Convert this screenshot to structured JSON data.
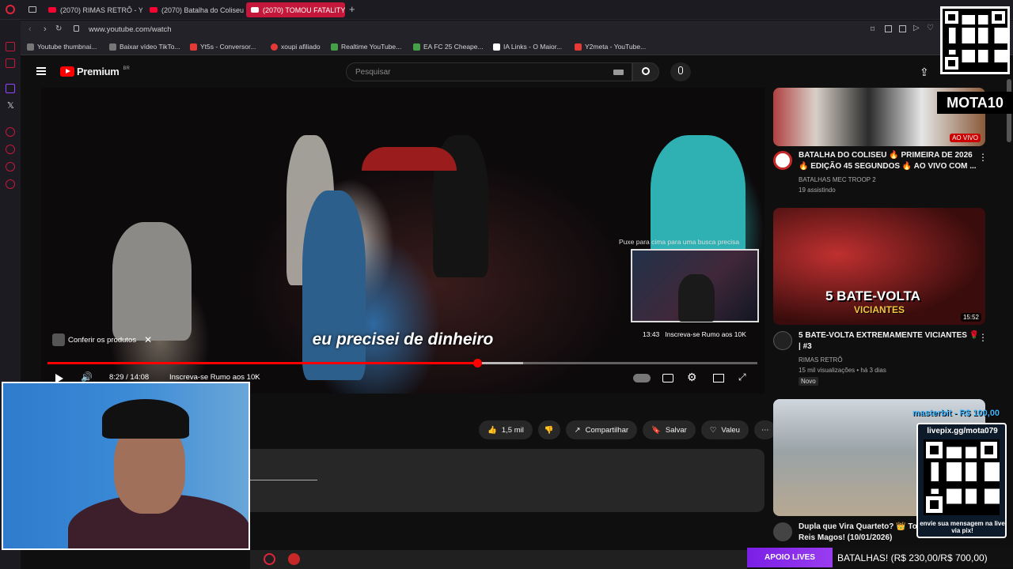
{
  "browser": {
    "tabs": [
      {
        "label": "(2070) RIMAS RETRÔ - Yo",
        "active": false
      },
      {
        "label": "(2070) Batalha do Coliseu",
        "active": false
      },
      {
        "label": "(2070) TOMOU FATALITY,",
        "active": true
      }
    ],
    "url": "www.youtube.com/watch",
    "bookmarks": [
      {
        "label": "Youtube thumbnai...",
        "color": "#777777"
      },
      {
        "label": "Baixar vídeo TikTo...",
        "color": "#777777"
      },
      {
        "label": "Yt5s - Conversor...",
        "color": "#e53935"
      },
      {
        "label": "xoupi afiliado",
        "color": "#e53935"
      },
      {
        "label": "Realtime YouTube...",
        "color": "#43a047"
      },
      {
        "label": "EA FC 25 Cheape...",
        "color": "#43a047"
      },
      {
        "label": "IA Links - O Maior...",
        "color": "#ffffff"
      },
      {
        "label": "Y2meta - YouTube...",
        "color": "#e53935"
      }
    ]
  },
  "youtube": {
    "logo": "Premium",
    "logo_region": "BR",
    "search_placeholder": "Pesquisar"
  },
  "video": {
    "subtitle": "eu precisei de dinheiro",
    "product_button": "Conferir os produtos",
    "pip_hint": "Puxe para cima para uma busca precisa",
    "preview_time": "13:43",
    "preview_label": "Inscreva-se Rumo aos 10K",
    "current_time": "8:29 / 14:08",
    "chapter": "Inscreva-se Rumo aos 10K",
    "progress": 0.605,
    "buffered": 0.67
  },
  "actions": {
    "likes": "1,5 mil",
    "share": "Compartilhar",
    "save": "Salvar",
    "thanks": "Valeu"
  },
  "recommendations": [
    {
      "title": "BATALHA DO COLISEU 🔥 PRIMEIRA DE 2026 🔥 EDIÇÃO 45 SEGUNDOS 🔥 AO VIVO COM ...",
      "channel": "BATALHAS MEC TROOP 2",
      "meta": "19 assistindo",
      "badge": "AO VIVO"
    },
    {
      "title": "5 BATE-VOLTA EXTREMAMENTE VICIANTES 🌹 | #3",
      "channel": "RIMAS RETRÔ",
      "meta": "15 mil visualizações • há 3 dias",
      "badge": "15:52",
      "tag": "Novo",
      "thumb_text": "5 BATE-VOLTA",
      "thumb_sub": "VICIANTES"
    },
    {
      "title": "Dupla que Vira Quarteto? 👑 To... Reis Magos! (10/01/2026)",
      "channel": "",
      "meta": ""
    }
  ],
  "overlay": {
    "streamer": "MOTA10",
    "donor": "masterbit - R$ 100,00",
    "pix_url": "livepix.gg/mota079",
    "pix_caption": "envie sua mensagem na live via pix!",
    "donate_label": "APOIO LIVES",
    "donate_goal": "BATALHAS! (R$ 230,00/R$ 700,00)"
  }
}
